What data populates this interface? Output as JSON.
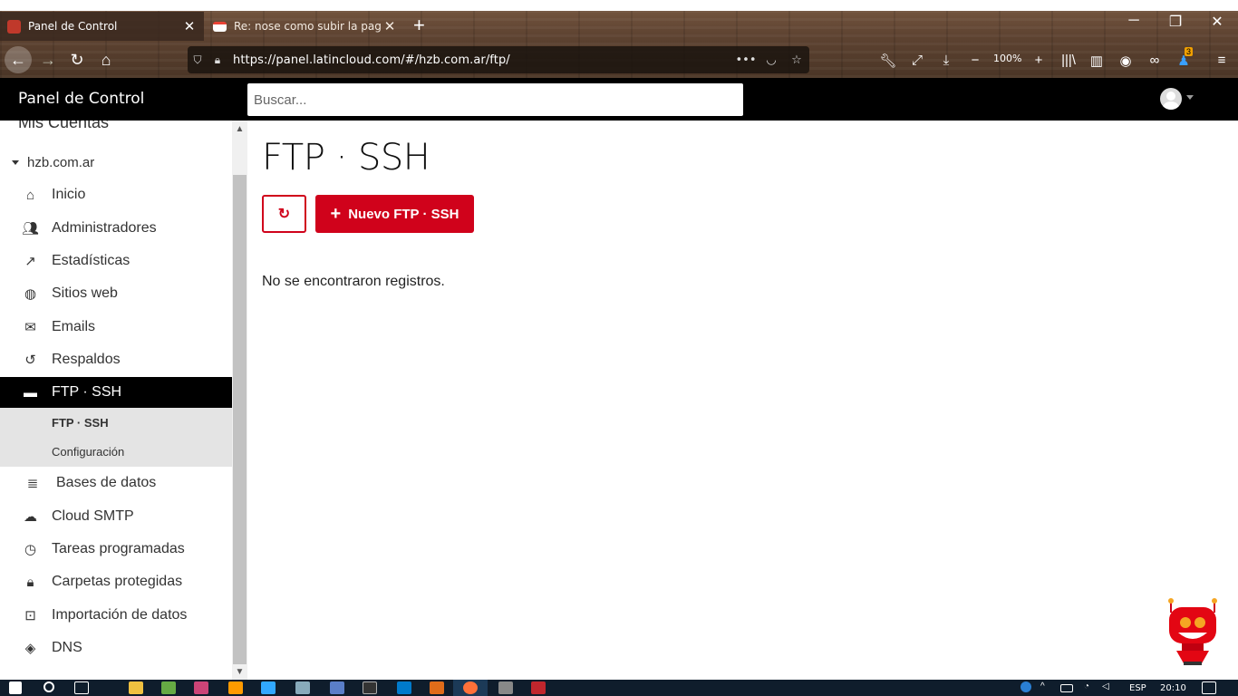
{
  "browser": {
    "tabs": [
      {
        "title": "Panel de Control",
        "favicon_color": "#c0392b"
      },
      {
        "title": "Re: nose como subir la pagina",
        "favicon_color": "#ea4335"
      }
    ],
    "url": "https://panel.latincloud.com/#/hzb.com.ar/ftp/",
    "zoom": "100%",
    "notification_count": "3"
  },
  "header": {
    "brand": "Panel de Control",
    "search_placeholder": "Buscar..."
  },
  "sidebar": {
    "section_title": "Mis Cuentas",
    "account": "hzb.com.ar",
    "items": [
      {
        "label": "Inicio",
        "icon": "home-icon"
      },
      {
        "label": "Administradores",
        "icon": "people-icon"
      },
      {
        "label": "Estadísticas",
        "icon": "trending-icon"
      },
      {
        "label": "Sitios web",
        "icon": "globe-icon"
      },
      {
        "label": "Emails",
        "icon": "mail-icon"
      },
      {
        "label": "Respaldos",
        "icon": "restore-icon"
      },
      {
        "label": "FTP · SSH",
        "icon": "folder-icon",
        "active": true
      },
      {
        "label": "Bases de datos",
        "icon": "database-icon"
      },
      {
        "label": "Cloud SMTP",
        "icon": "cloud-upload-icon"
      },
      {
        "label": "Tareas programadas",
        "icon": "clock-icon"
      },
      {
        "label": "Carpetas protegidas",
        "icon": "lock-icon"
      },
      {
        "label": "Importación de datos",
        "icon": "import-icon"
      },
      {
        "label": "DNS",
        "icon": "compass-icon"
      }
    ],
    "submenu": [
      {
        "label": "FTP · SSH"
      },
      {
        "label": "Configuración"
      }
    ]
  },
  "main": {
    "title": "FTP · SSH",
    "new_button": "Nuevo FTP · SSH",
    "empty_message": "No se encontraron registros."
  },
  "taskbar": {
    "language": "ESP",
    "time": "20:10"
  },
  "colors": {
    "accent": "#d0021b",
    "header_bg": "#000000",
    "submenu_bg": "#e4e4e4"
  }
}
